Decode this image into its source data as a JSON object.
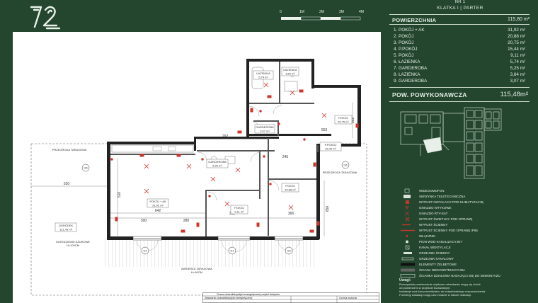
{
  "logo": {
    "text": "72"
  },
  "scale": {
    "labels": [
      "0",
      "1M",
      "2M",
      "3M",
      "4M"
    ]
  },
  "header": {
    "apartment": "NR 1",
    "klatka": "KLATKA I | PARTER"
  },
  "summary": {
    "powierzchnia_label": "POWIERZCHNIA",
    "powierzchnia_value": "115,80 m²",
    "rooms": [
      {
        "name": "1. POKÓJ + AK",
        "area": "31,92 m²"
      },
      {
        "name": "2. POKÓJ",
        "area": "20,88 m²"
      },
      {
        "name": "3. POKÓJ",
        "area": "20,75 m²"
      },
      {
        "name": "4. P.POKÓJ",
        "area": "15,44 m²"
      },
      {
        "name": "5. POKÓJ",
        "area": "9,11 m²"
      },
      {
        "name": "6. ŁAZIENKA",
        "area": "5,74 m²"
      },
      {
        "name": "7. GARDEROBA",
        "area": "5,25 m²"
      },
      {
        "name": "8. ŁAZIENKA",
        "area": "3,64 m²"
      },
      {
        "name": "9. GARDEROBA",
        "area": "3,07 m²"
      }
    ],
    "powykonawcza_label": "POW. POWYKONAWCZA",
    "powykonawcza_value": "115,48m²"
  },
  "legend": [
    {
      "label": "WIDEOOMOFON",
      "color": "#d9e3d9"
    },
    {
      "label": "SKRZYNKA TELETECHNICZNA",
      "color": "#d9e3d9"
    },
    {
      "label": "WYPUST INSTALACJI POD KLIMATYZACJĘ",
      "color": "#c0392b"
    },
    {
      "label": "GNIAZDO WTYKOWE",
      "color": "#c0392b"
    },
    {
      "label": "GNIAZDO RTV-SAT",
      "color": "#c0392b"
    },
    {
      "label": "WYPUST ŚWIETLNY POD OPRAWĘ",
      "color": "#c0392b"
    },
    {
      "label": "WYPUST ŚCIENNY",
      "color": "#c0392b"
    },
    {
      "label": "WYPUST ŚCIENNY POD OPRAWĘ IP65",
      "color": "#c0392b"
    },
    {
      "label": "WŁĄCZNIK",
      "color": "#c0392b"
    },
    {
      "label": "PION WOD-KANALIZACYJNY",
      "color": "#d9e3d9"
    },
    {
      "label": "KANAŁ WENTYLACJI",
      "color": "#d9e3d9"
    },
    {
      "label": "GRZEJNIK ŚCIENNY",
      "color": "#d9e3d9"
    },
    {
      "label": "GRZEJNIK KANAŁOWY",
      "color": "#d9e3d9"
    },
    {
      "label": "ELEMENTY ŻELBETOWE",
      "color": "#111111"
    },
    {
      "label": "ŚCIANA NIEKONSTRUKCYJNA",
      "color": "#666666"
    },
    {
      "label": "ŚCIANKA DZIAŁOWA NADAJĄCA SIĘ DO DEMONTAŻU",
      "color": "#d9e3d9"
    }
  ],
  "notes": {
    "title": "Uwagi:",
    "lines": [
      "Rzeczywiste powierzchnie użytkowe mieszkania mogą się różnić",
      "od powierzchni w projekcie budowlanym.",
      "Instalacje wod-kan przewidziano do indywidualnego rozprowadzenia.",
      "Przebiegi instalacji mogą ulec zmianie w trakcie realizacji."
    ]
  },
  "plan": {
    "rooms": [
      {
        "label": "POKÓJ + AK",
        "area": "31,92 m²"
      },
      {
        "label": "ŁAZIENKA",
        "area": "5,74 m²"
      },
      {
        "label": "ŁAZIENKA",
        "area": "3,64 m²"
      },
      {
        "label": "GARDEROBA",
        "area": "3,07 m²"
      },
      {
        "label": "POKÓJ",
        "area": "20,75 m²"
      },
      {
        "label": "POKÓJ",
        "area": "20,88 m²"
      },
      {
        "label": "POKÓJ",
        "area": "9,11 m²"
      },
      {
        "label": "GARDEROBA",
        "area": "5,25 m²"
      },
      {
        "label": "P.POKÓJ",
        "area": "15,44 m²"
      },
      {
        "label": "OGRÓDEK",
        "area": "121,43 m²"
      }
    ],
    "labels": {
      "przegroda_left": "PRZEGRODA TARASOWA",
      "przegroda_right": "PRZEGRODA TARASOWA",
      "ogrodzenie": "OGRODZENIE AŻUROWE",
      "ogrodzenie_h": "H=100CM",
      "bariera": "BARIERKA TARASOWA",
      "bariera_h": "H=90CM",
      "win_g1": "G1",
      "win_g3": "G3",
      "win_g4": "G4",
      "win_g5": "G5",
      "win_g6": "G6"
    },
    "dims": {
      "d520": "520",
      "d642": "642",
      "d300": "300",
      "d280": "280",
      "d382": "382",
      "d366": "366",
      "d553": "553",
      "d292": "292",
      "d245": "245",
      "d650": "650",
      "d516": "516",
      "d351": "351"
    }
  },
  "energy": {
    "line1": "Ocena charakterystyki energetycznej części budynku",
    "line2": "Wskaźnik charakterystyki energetycznej",
    "line3": "Ocena zużycia"
  }
}
